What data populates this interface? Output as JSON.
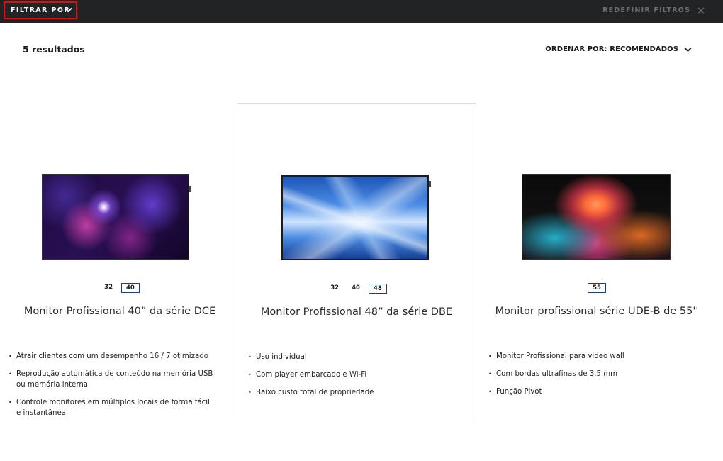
{
  "topbar": {
    "filter_label": "FILTRAR POR",
    "reset_label": "REDEFINIR FILTROS"
  },
  "results_label": "5 resultados",
  "sort_label": "ORDENAR POR: RECOMENDADOS",
  "products": [
    {
      "sizes": [
        "32",
        "40"
      ],
      "active_size": "40",
      "title": "Monitor Profissional 40” da série DCE",
      "features": [
        "Atrair clientes com um desempenho 16 / 7 otimizado",
        "Reprodução automática de conteúdo na memória USB ou memória interna",
        "Controle monitores em múltiplos locais de forma fácil e instantânea"
      ]
    },
    {
      "sizes": [
        "32",
        "40",
        "48"
      ],
      "active_size": "48",
      "title": "Monitor Profissional 48” da série DBE",
      "features": [
        "Uso individual",
        "Com player embarcado e Wi-Fi",
        "Baixo custo total de propriedade"
      ]
    },
    {
      "sizes": [
        "55"
      ],
      "active_size": "55",
      "title": "Monitor profissional série UDE-B de 55''",
      "features": [
        "Monitor Profissional para video wall",
        "Com bordas ultrafinas de 3.5 mm",
        "Função Pivot"
      ]
    }
  ],
  "icons": {
    "filter_toggle": "chevron-down-icon",
    "reset": "close-icon",
    "sort_toggle": "chevron-down-icon"
  }
}
